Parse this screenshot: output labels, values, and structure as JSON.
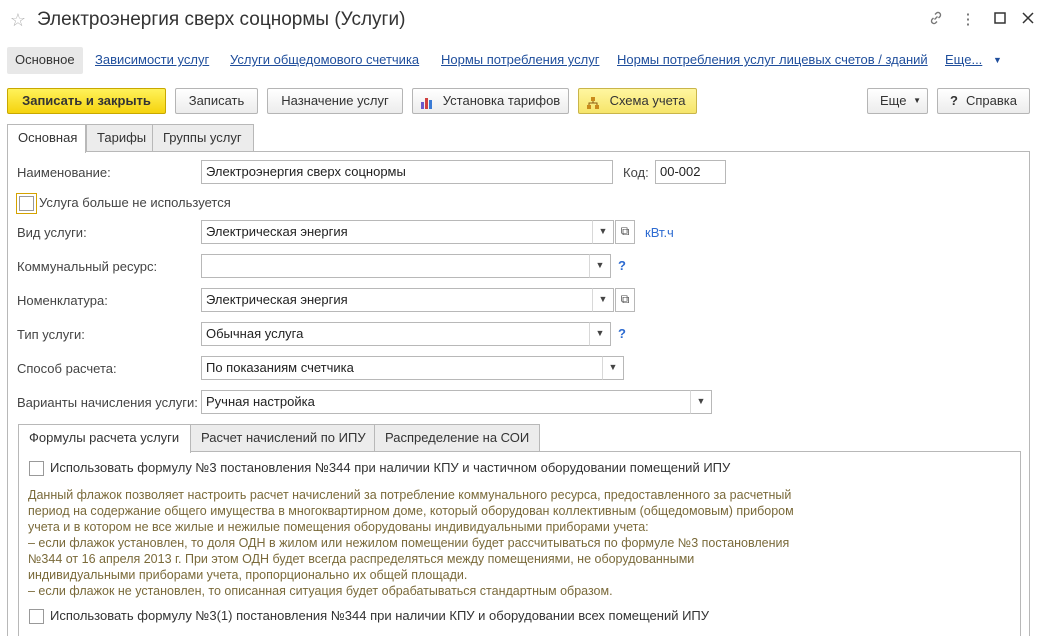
{
  "window": {
    "title": "Электроэнергия сверх соцнормы (Услуги)"
  },
  "nav": {
    "items": [
      "Основное",
      "Зависимости услуг",
      "Услуги общедомового счетчика",
      "Нормы потребления услуг",
      "Нормы потребления услуг лицевых счетов / зданий",
      "Еще..."
    ]
  },
  "toolbar": {
    "save_close": "Записать и закрыть",
    "save": "Записать",
    "assign": "Назначение услуг",
    "tariffs": "Установка тарифов",
    "scheme": "Схема учета",
    "more": "Еще",
    "help": "Справка"
  },
  "tabs": [
    "Основная",
    "Тарифы",
    "Группы услуг"
  ],
  "form": {
    "name_label": "Наименование:",
    "name_value": "Электроэнергия сверх соцнормы",
    "code_label": "Код:",
    "code_value": "00-002",
    "unused_label": "Услуга больше не используется",
    "kind_label": "Вид услуги:",
    "kind_value": "Электрическая энергия",
    "unit_link": "кВт.ч",
    "resource_label": "Коммунальный ресурс:",
    "resource_value": "",
    "nomenclature_label": "Номенклатура:",
    "nomenclature_value": "Электрическая энергия",
    "type_label": "Тип услуги:",
    "type_value": "Обычная услуга",
    "method_label": "Способ расчета:",
    "method_value": "По показаниям счетчика",
    "variants_label": "Варианты начисления услуги:",
    "variants_value": "Ручная настройка",
    "help_mark": "?"
  },
  "subtabs": [
    "Формулы расчета услуги",
    "Расчет начислений по ИПУ",
    "Распределение на СОИ"
  ],
  "formulas": {
    "opt1": "Использовать формулу №3 постановления №344 при наличии КПУ и частичном оборудовании помещений ИПУ",
    "hint": [
      "Данный флажок позволяет настроить расчет начислений за потребление коммунального ресурса, предоставленного за расчетный",
      "период на содержание общего имущества в многоквартирном доме, который оборудован коллективным (общедомовым) прибором",
      "учета и в котором не все жилые и нежилые помещения оборудованы индивидуальными приборами учета:",
      "– если флажок установлен, то доля ОДН в жилом или нежилом помещении будет рассчитываться по формуле №3 постановления",
      "№344 от 16 апреля 2013 г. При этом ОДН будет всегда распределяться между помещениями, не оборудованными",
      "индивидуальными приборами учета, пропорционально их общей площади.",
      "– если флажок не установлен, то описанная ситуация будет обрабатываться стандартным образом."
    ],
    "opt2": "Использовать формулу №3(1) постановления №344 при наличии КПУ и оборудовании всех помещений ИПУ"
  }
}
